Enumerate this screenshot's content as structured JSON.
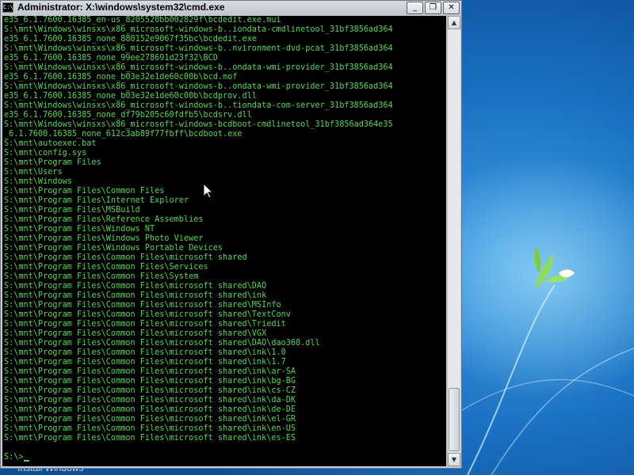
{
  "window": {
    "title": "Administrator: X:\\windows\\system32\\cmd.exe",
    "icon_label": "C:\\",
    "controls": {
      "minimize": "_",
      "maximize": "❐",
      "close": "✕"
    }
  },
  "console": {
    "lines": [
      "e35_6.1.7600.16385_en-us_8205520bb002829f\\bcdedit.exe.mui",
      "S:\\mnt\\Windows\\winsxs\\x86_microsoft-windows-b..iondata-cmdlinetool_31bf3856ad364",
      "e35_6.1.7600.16385_none_880152e9067f35bc\\bcdedit.exe",
      "S:\\mnt\\Windows\\winsxs\\x86_microsoft-windows-b..nvironment-dvd-pcat_31bf3856ad364",
      "e35_6.1.7600.16385_none_99ee278691d23f32\\BCD",
      "S:\\mnt\\Windows\\winsxs\\x86_microsoft-windows-b..ondata-wmi-provider_31bf3856ad364",
      "e35_6.1.7600.16385_none_b03e32e1de60c00b\\bcd.mof",
      "S:\\mnt\\Windows\\winsxs\\x86_microsoft-windows-b..ondata-wmi-provider_31bf3856ad364",
      "e35_6.1.7600.16385_none_b03e32e1de60c00b\\bcdprov.dll",
      "S:\\mnt\\Windows\\winsxs\\x86_microsoft-windows-b..tiondata-com-server_31bf3856ad364",
      "e35_6.1.7600.16385_none_df79b205c60fdfb5\\bcdsrv.dll",
      "S:\\mnt\\Windows\\winsxs\\x86_microsoft-windows-bcdboot-cmdlinetool_31bf3856ad364e35",
      "_6.1.7600.16385_none_612c3ab89f77fbff\\bcdboot.exe",
      "S:\\mnt\\autoexec.bat",
      "S:\\mnt\\config.sys",
      "S:\\mnt\\Program Files",
      "S:\\mnt\\Users",
      "S:\\mnt\\Windows",
      "S:\\mnt\\Program Files\\Common Files",
      "S:\\mnt\\Program Files\\Internet Explorer",
      "S:\\mnt\\Program Files\\MSBuild",
      "S:\\mnt\\Program Files\\Reference Assemblies",
      "S:\\mnt\\Program Files\\Windows NT",
      "S:\\mnt\\Program Files\\Windows Photo Viewer",
      "S:\\mnt\\Program Files\\Windows Portable Devices",
      "S:\\mnt\\Program Files\\Common Files\\microsoft shared",
      "S:\\mnt\\Program Files\\Common Files\\Services",
      "S:\\mnt\\Program Files\\Common Files\\System",
      "S:\\mnt\\Program Files\\Common Files\\microsoft shared\\DAO",
      "S:\\mnt\\Program Files\\Common Files\\microsoft shared\\ink",
      "S:\\mnt\\Program Files\\Common Files\\microsoft shared\\MSInfo",
      "S:\\mnt\\Program Files\\Common Files\\microsoft shared\\TextConv",
      "S:\\mnt\\Program Files\\Common Files\\microsoft shared\\Triedit",
      "S:\\mnt\\Program Files\\Common Files\\microsoft shared\\VGX",
      "S:\\mnt\\Program Files\\Common Files\\microsoft shared\\DAO\\dao360.dll",
      "S:\\mnt\\Program Files\\Common Files\\microsoft shared\\ink\\1.0",
      "S:\\mnt\\Program Files\\Common Files\\microsoft shared\\ink\\1.7",
      "S:\\mnt\\Program Files\\Common Files\\microsoft shared\\ink\\ar-SA",
      "S:\\mnt\\Program Files\\Common Files\\microsoft shared\\ink\\bg-BG",
      "S:\\mnt\\Program Files\\Common Files\\microsoft shared\\ink\\cs-CZ",
      "S:\\mnt\\Program Files\\Common Files\\microsoft shared\\ink\\da-DK",
      "S:\\mnt\\Program Files\\Common Files\\microsoft shared\\ink\\de-DE",
      "S:\\mnt\\Program Files\\Common Files\\microsoft shared\\ink\\el-GR",
      "S:\\mnt\\Program Files\\Common Files\\microsoft shared\\ink\\en-US",
      "S:\\mnt\\Program Files\\Common Files\\microsoft shared\\ink\\es-ES"
    ],
    "prompt": "S:\\>"
  },
  "desktop": {
    "taskbar_label": "Install Windows",
    "wallpaper_icon": "windows-fish-logo"
  },
  "colors": {
    "console_text": "#4cd94c",
    "console_bg": "#000000",
    "desktop_bg": "#1c6fb7"
  }
}
